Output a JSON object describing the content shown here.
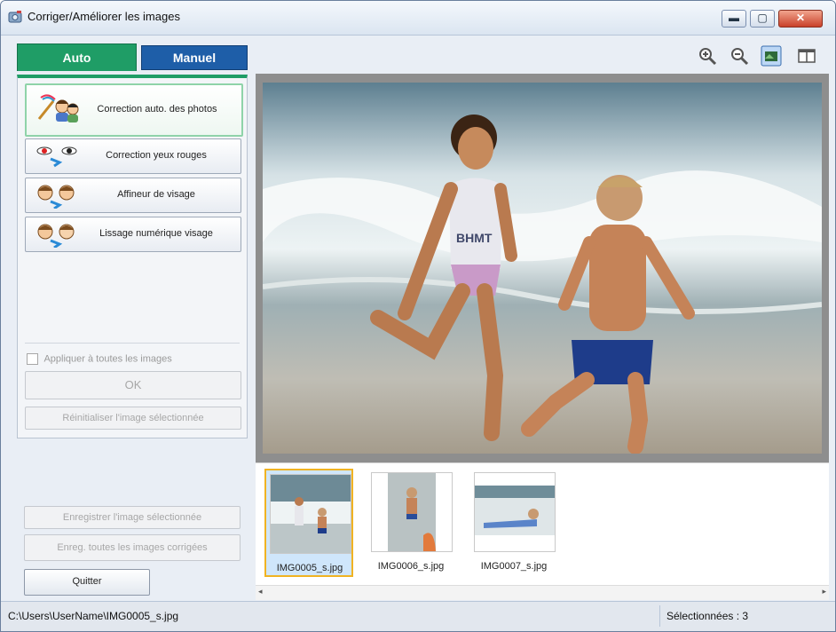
{
  "window": {
    "title": "Corriger/Améliorer les images",
    "buttons": [
      "minimize",
      "maximize",
      "close"
    ]
  },
  "tabs": [
    {
      "label": "Auto",
      "active": true
    },
    {
      "label": "Manuel",
      "active": false
    }
  ],
  "auto_panel": {
    "buttons": [
      {
        "label": "Correction auto. des photos",
        "icon": "auto-photo-correction-icon",
        "selected": true
      },
      {
        "label": "Correction yeux rouges",
        "icon": "red-eye-icon",
        "selected": false
      },
      {
        "label": "Affineur de visage",
        "icon": "face-sharpener-icon",
        "selected": false
      },
      {
        "label": "Lissage numérique visage",
        "icon": "face-smoothing-icon",
        "selected": false
      }
    ],
    "apply_all_label": "Appliquer à toutes les images",
    "ok_label": "OK",
    "reset_label": "Réinitialiser l'image sélectionnée"
  },
  "save": {
    "save_selected_label": "Enregistrer l'image sélectionnée",
    "save_all_label": "Enreg. toutes les images corrigées"
  },
  "quit_label": "Quitter",
  "toolbar": {
    "icons": [
      "zoom-in-icon",
      "zoom-out-icon",
      "whole-image-view-icon",
      "compare-view-icon"
    ]
  },
  "thumbnails": [
    {
      "filename": "IMG0005_s.jpg",
      "selected": true
    },
    {
      "filename": "IMG0006_s.jpg",
      "selected": false
    },
    {
      "filename": "IMG0007_s.jpg",
      "selected": false
    }
  ],
  "status": {
    "path": "C:\\Users\\UserName\\IMG0005_s.jpg",
    "selected_count": "Sélectionnées : 3"
  },
  "colors": {
    "auto_tab": "#1f9d66",
    "manual_tab": "#1e5ea8",
    "thumb_selection": "#f0b323"
  }
}
